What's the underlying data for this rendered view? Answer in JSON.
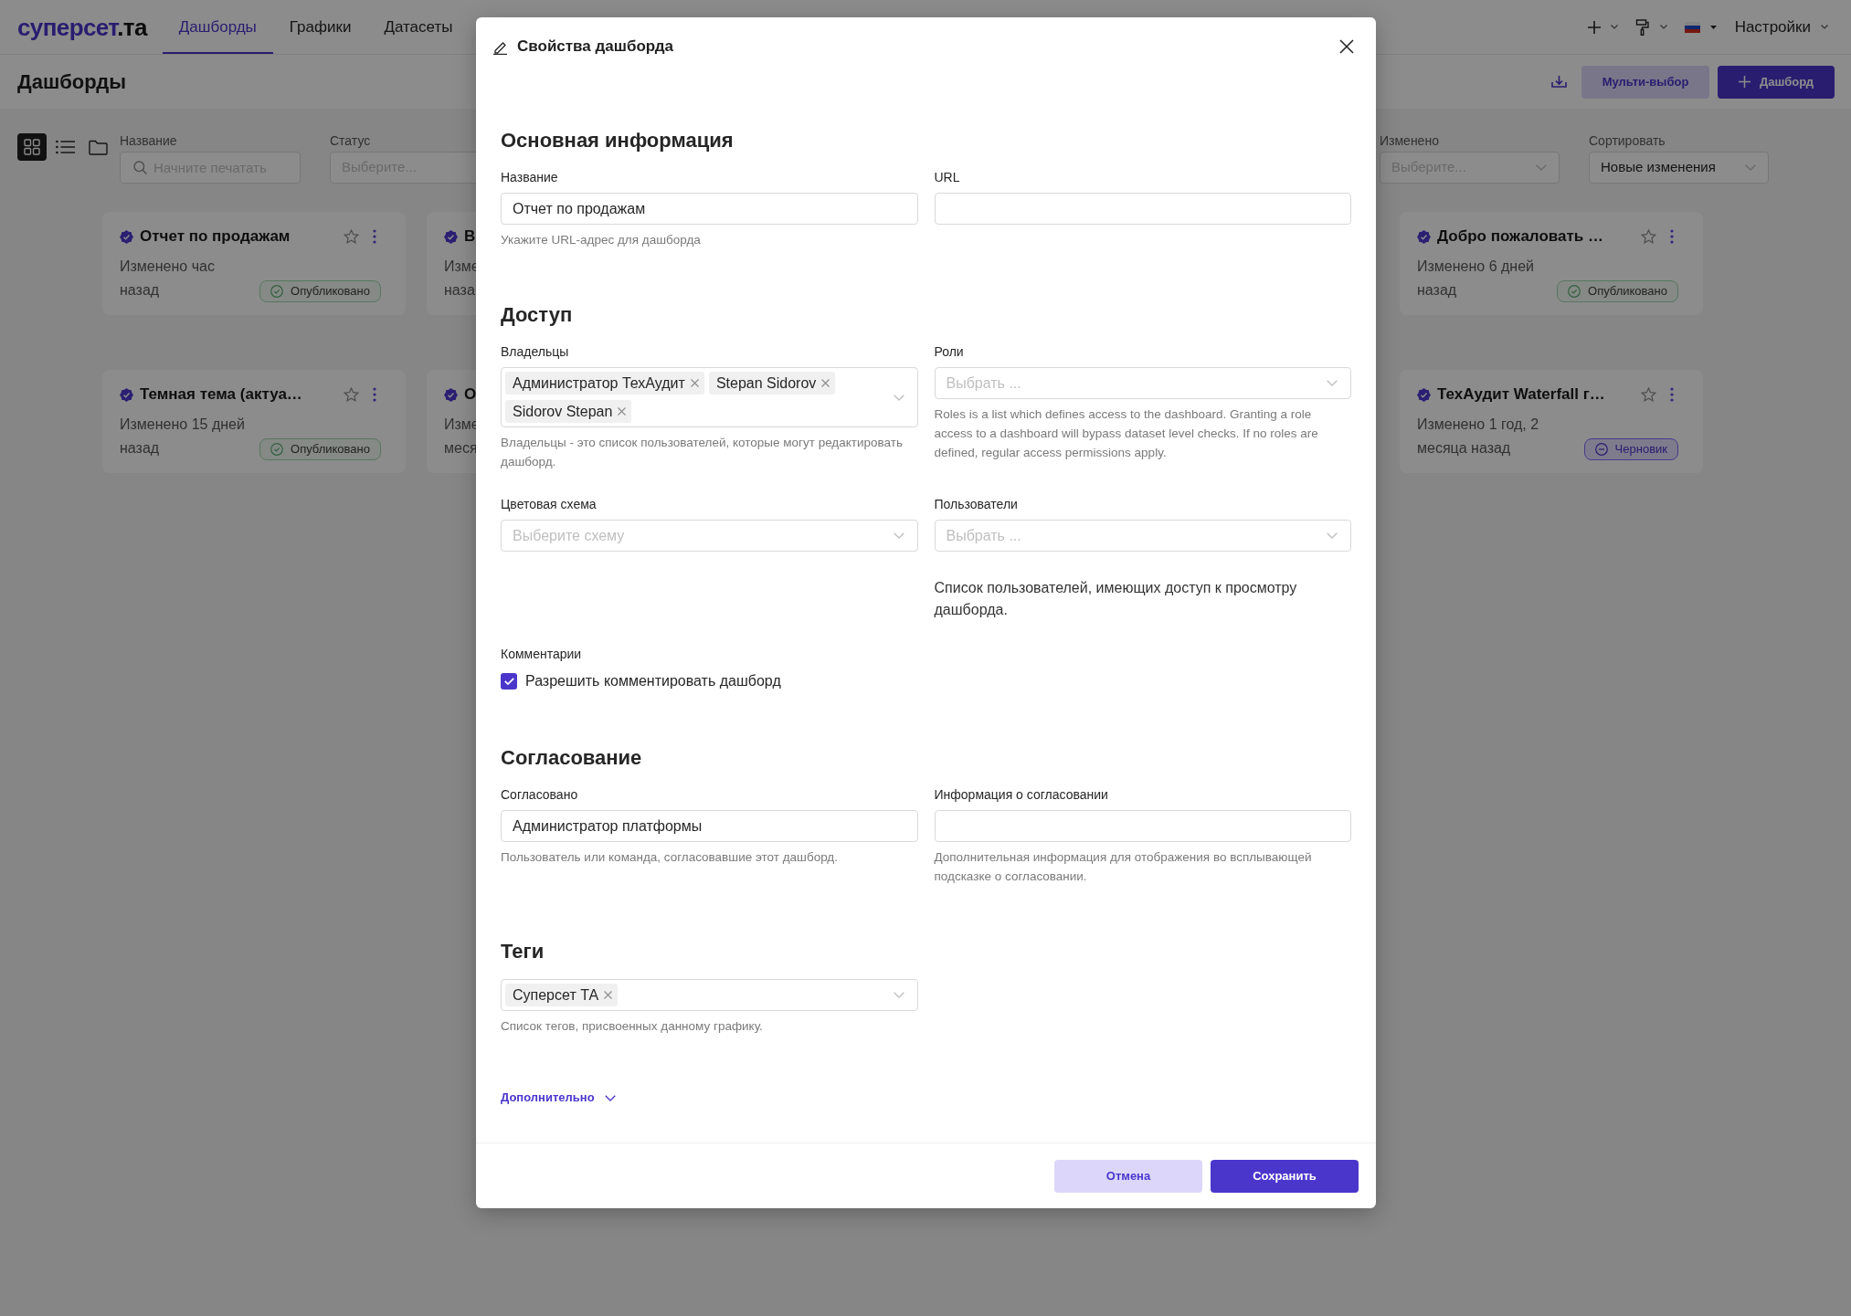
{
  "navbar": {
    "logo": {
      "main": "суперсет",
      "suffix": ".та"
    },
    "tabs": [
      {
        "label": "Дашборды",
        "selected": true
      },
      {
        "label": "Графики",
        "selected": false
      },
      {
        "label": "Датасеты",
        "selected": false
      }
    ],
    "settings_menu": {
      "label": "Настройки"
    }
  },
  "header": {
    "title": "Дашборды",
    "buttons": [
      {
        "label": "Мульти-выбор",
        "kind": "secondary"
      },
      {
        "label": "Дашборд",
        "kind": "create"
      }
    ]
  },
  "view_modes": [
    {
      "kind": "grid",
      "selected": true
    },
    {
      "kind": "list",
      "selected": false
    },
    {
      "kind": "folder",
      "selected": false
    }
  ],
  "filter_groups": [
    [
      {
        "label": "Название",
        "kind": "search",
        "placeholder": "Начните печатать"
      },
      {
        "label": "Статус",
        "kind": "clipped",
        "placeholder": "Выберите..."
      }
    ],
    [
      {
        "label": "Изменено",
        "kind": "select",
        "placeholder": "Выберите..."
      },
      {
        "label": "Сортировать",
        "kind": "select",
        "value": "Новые изменения"
      }
    ]
  ],
  "card_rows": [
    [
      {
        "kind": "full",
        "title": "Отчет по продажам",
        "certified": true,
        "starred": false,
        "modified": [
          "Изменено час",
          "назад"
        ],
        "status": {
          "kind": "published",
          "label": "Опубликовано"
        }
      },
      {
        "kind": "clipped",
        "title": "В",
        "certified": true,
        "modified": [
          "Изме",
          "наза"
        ]
      },
      {
        "kind": "full",
        "title": "Добро пожаловать …",
        "certified": true,
        "starred": false,
        "modified": [
          "Изменено 6 дней",
          "назад"
        ],
        "status": {
          "kind": "published",
          "label": "Опубликовано"
        }
      }
    ],
    [
      {
        "kind": "full",
        "title": "Темная тема (актуа…",
        "certified": true,
        "starred": false,
        "modified": [
          "Изменено 15 дней",
          "назад"
        ],
        "status": {
          "kind": "published",
          "label": "Опубликовано"
        }
      },
      {
        "kind": "clipped",
        "title": "О",
        "certified": true,
        "modified": [
          "Изме",
          "меся"
        ]
      },
      {
        "kind": "full",
        "title": "ТехАудит Waterfall г…",
        "certified": true,
        "starred": false,
        "modified": [
          "Изменено 1 год, 2",
          "месяца назад"
        ],
        "status": {
          "kind": "draft",
          "label": "Черновик"
        }
      }
    ]
  ],
  "modal": {
    "title": "Свойства дашборда",
    "sections": [
      {
        "heading": "Основная информация",
        "fields": [
          {
            "kind": "text",
            "label": "Название",
            "value": "Отчет по продажам",
            "help": "Укажите URL-адрес для дашборда"
          },
          {
            "kind": "text",
            "label": "URL"
          }
        ]
      },
      {
        "heading": "Доступ",
        "fields": [
          {
            "kind": "multiselect",
            "label": "Владельцы",
            "tags": [
              "Администратор ТехАудит",
              "Stepan Sidorov",
              "Sidorov Stepan"
            ],
            "help": "Владельцы - это список пользователей, которые могут редактировать дашборд."
          },
          {
            "kind": "select",
            "label": "Роли",
            "placeholder": "Выбрать ...",
            "help": "Roles is a list which defines access to the dashboard. Granting a role access to a dashboard will bypass dataset level checks. If no roles are defined, regular access permissions apply."
          },
          {
            "kind": "select",
            "label": "Цветовая схема",
            "placeholder": "Выберите схему"
          },
          {
            "kind": "select",
            "label": "Пользователи",
            "placeholder": "Выбрать ...",
            "note": "Список пользователей, имеющих доступ к просмотру дашборда."
          },
          {
            "kind": "checkbox",
            "label": "Комментарии",
            "option": "Разрешить комментировать дашборд",
            "checked": true
          }
        ]
      },
      {
        "heading": "Согласование",
        "fields": [
          {
            "kind": "text",
            "label": "Согласовано",
            "value": "Администратор платформы",
            "help": "Пользователь или команда, согласовавшие этот дашборд."
          },
          {
            "kind": "text",
            "label": "Информация о согласовании",
            "help": "Дополнительная информация для отображения во всплывающей подсказке о согласовании."
          }
        ]
      },
      {
        "heading": "Теги",
        "fields": [
          {
            "kind": "multiselect",
            "tags": [
              "Суперсет ТА"
            ],
            "help": "Список тегов, присвоенных данному графику."
          }
        ]
      }
    ],
    "advanced_toggle": "Дополнительно",
    "buttons": [
      {
        "label": "Отмена",
        "kind": "secondary"
      },
      {
        "label": "Сохранить",
        "kind": "primary"
      }
    ]
  }
}
